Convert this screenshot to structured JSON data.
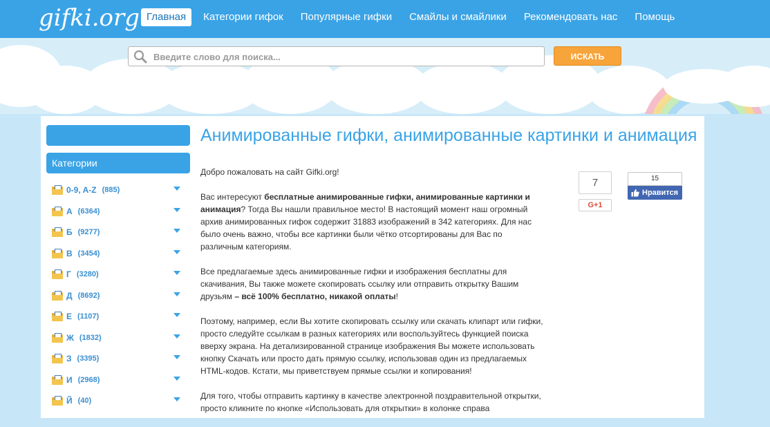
{
  "header": {
    "logo": "gifki.org",
    "nav": [
      {
        "label": "Главная",
        "active": true
      },
      {
        "label": "Категории гифок",
        "active": false
      },
      {
        "label": "Популярные гифки",
        "active": false
      },
      {
        "label": "Смайлы и смайлики",
        "active": false
      },
      {
        "label": "Рекомендовать нас",
        "active": false
      },
      {
        "label": "Помощь",
        "active": false
      }
    ]
  },
  "search": {
    "placeholder": "Введите слово для поиска...",
    "value": "",
    "button_label": "ИСКАТЬ",
    "icon": "search-icon"
  },
  "sidebar": {
    "header": "Категории",
    "categories": [
      {
        "name": "0-9, A-Z",
        "count": "(885)"
      },
      {
        "name": "А",
        "count": "(6364)"
      },
      {
        "name": "Б",
        "count": "(9277)"
      },
      {
        "name": "В",
        "count": "(3454)"
      },
      {
        "name": "Г",
        "count": "(3280)"
      },
      {
        "name": "Д",
        "count": "(8692)"
      },
      {
        "name": "Е",
        "count": "(1107)"
      },
      {
        "name": "Ж",
        "count": "(1832)"
      },
      {
        "name": "З",
        "count": "(3395)"
      },
      {
        "name": "И",
        "count": "(2968)"
      },
      {
        "name": "Й",
        "count": "(40)"
      }
    ]
  },
  "main": {
    "title": "Анимированные гифки, анимированные картинки и анимация",
    "welcome": "Добро пожаловать на сайт Gifki.org!",
    "p1_a": "Вас интересуют ",
    "p1_bold": "бесплатные анимированные гифки, анимированные картинки и анимация",
    "p1_b": "? Тогда Вы нашли правильное место! В настоящий момент наш огромный архив анимированных гифок содержит 31883 изображений в 342 категориях. Для нас было очень важно, чтобы все картинки были чётко отсортированы для Вас по различным категориям.",
    "p2_a": "Все предлагаемые здесь анимированные гифки и изображения бесплатны для скачивания, Вы также можете скопировать ссылку или отправить открытку Вашим друзьям ",
    "p2_bold": "– всё 100% бесплатно, никакой оплаты",
    "p2_b": "!",
    "p3": "Поэтому, например, если Вы хотите скопировать ссылку или скачать клипарт или гифки, просто следуйте ссылкам в разных категориях или воспользуйтесь функцией поиска вверху экрана. На детализированной странице изображения Вы можете использовать кнопку Скачать или просто дать прямую ссылку, использовав один из предлагаемых HTML-кодов. Кстати, мы приветствуем прямые ссылки и копирования!",
    "p4": "Для того, чтобы отправить картинку в качестве электронной поздравительной открытки, просто кликните по кнопке «Использовать для открытки» в колонке справа"
  },
  "social": {
    "gplus_count": "7",
    "gplus_label": "G+1",
    "fb_count": "15",
    "fb_label": "Нравится"
  },
  "colors": {
    "brand_blue": "#3aa3e6",
    "search_orange": "#f7a43a",
    "facebook_blue": "#4267b2"
  }
}
